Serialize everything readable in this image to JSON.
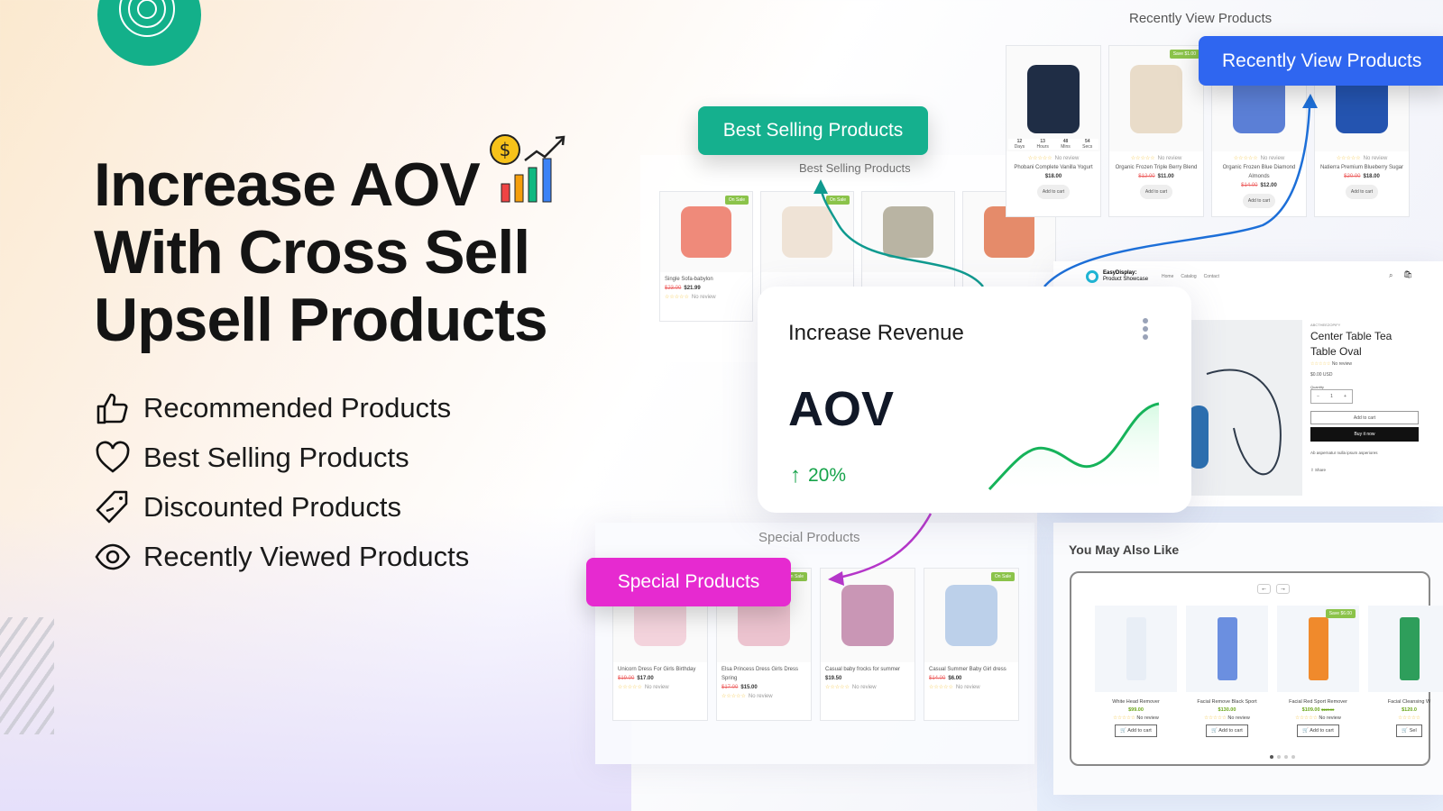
{
  "hero": {
    "title_lines": [
      "Increase AOV",
      "With Cross Sell",
      "Upsell Products"
    ],
    "features": [
      {
        "icon": "thumbs-up-icon",
        "label": "Recommended Products"
      },
      {
        "icon": "heart-icon",
        "label": "Best Selling Products"
      },
      {
        "icon": "tag-icon",
        "label": "Discounted Products"
      },
      {
        "icon": "eye-icon",
        "label": "Recently Viewed Products"
      }
    ]
  },
  "badges": {
    "best_selling": "Best Selling Products",
    "recently_view": "Recently View Products",
    "special": "Special Products"
  },
  "colors": {
    "teal": "#15b08e",
    "blue": "#2f66f0",
    "pink": "#e62ad0",
    "green": "#16a34a"
  },
  "best_selling": {
    "title": "Best Selling Products",
    "products": [
      {
        "name": "Single Sofa-babylon",
        "price": "$21.99",
        "old": "$23.00",
        "tag": "On Sale",
        "rating": "No review"
      },
      {
        "tag": "On Sale"
      },
      {},
      {}
    ]
  },
  "recently_viewed": {
    "title": "Recently View Products",
    "countdown": [
      {
        "v": "12",
        "l": "Days"
      },
      {
        "v": "13",
        "l": "Hours"
      },
      {
        "v": "48",
        "l": "Mins"
      },
      {
        "v": "54",
        "l": "Secs"
      }
    ],
    "products": [
      {
        "name": "Phobani Complete Vanilla Yogurt",
        "price": "$18.00",
        "old": "",
        "rating": "No review",
        "cta": "Add to cart"
      },
      {
        "name": "Organic Frozen Triple Berry Blend",
        "price": "$11.00",
        "old": "$12.00",
        "tag": "Save $1.00",
        "rating": "No review",
        "cta": "Add to cart"
      },
      {
        "name": "Organic Frozen Blue Diamond Almonds",
        "price": "$12.00",
        "old": "$14.00",
        "rating": "No review",
        "cta": "Add to cart"
      },
      {
        "name": "Natierra Premium Blueberry Sugar",
        "price": "$18.00",
        "old": "$20.00",
        "rating": "No review",
        "cta": "Add to cart"
      }
    ]
  },
  "revenue": {
    "title": "Increase Revenue",
    "metric": "AOV",
    "change": "20%"
  },
  "product_page": {
    "brand": "EasyDisplay:",
    "brand_sub": "Product Showcase",
    "nav": [
      "Home",
      "Catalog",
      "Contact"
    ],
    "vendor": "ABCTHEEZOPIFY",
    "title": "Center Table Tea Table Oval",
    "rating": "No review",
    "price": "$0.00 USD",
    "qty_label": "Quantity",
    "qty": "1",
    "add": "Add to cart",
    "buy": "Buy it now",
    "desc": "Ab aspernatur nulla ipsum asperiores",
    "share": "Share"
  },
  "special": {
    "title": "Special Products",
    "products": [
      {
        "name": "Unicorn Dress For Girls Birthday",
        "price": "$17.00",
        "old": "$19.00",
        "rating": "No review"
      },
      {
        "name": "Elsa Princess Dress Girls Dress Spring",
        "price": "$15.00",
        "old": "$17.00",
        "tag": "On Sale",
        "rating": "No review"
      },
      {
        "name": "Casual baby frocks for summer",
        "price": "$19.50",
        "old": "",
        "rating": "No review"
      },
      {
        "name": "Casual Summer Baby Girl dress",
        "price": "$6.00",
        "old": "$14.00",
        "tag": "On Sale",
        "rating": "No review"
      }
    ]
  },
  "also_like": {
    "title": "You May Also Like",
    "products": [
      {
        "name": "White Head Remover",
        "price": "$99.00",
        "old": "",
        "rating": "No review",
        "cta": "Add to cart"
      },
      {
        "name": "Facial Remove Black Sport",
        "price": "$130.00",
        "old": "",
        "rating": "No review",
        "cta": "Add to cart"
      },
      {
        "name": "Facial Red Sport Remover",
        "price": "$109.00",
        "old": "$115.00",
        "tag": "Save $6.00",
        "rating": "No review",
        "cta": "Add to cart"
      },
      {
        "name": "Facial Cleansing W",
        "price": "$120.0",
        "old": "",
        "rating": "",
        "cta": "Sel"
      }
    ]
  }
}
